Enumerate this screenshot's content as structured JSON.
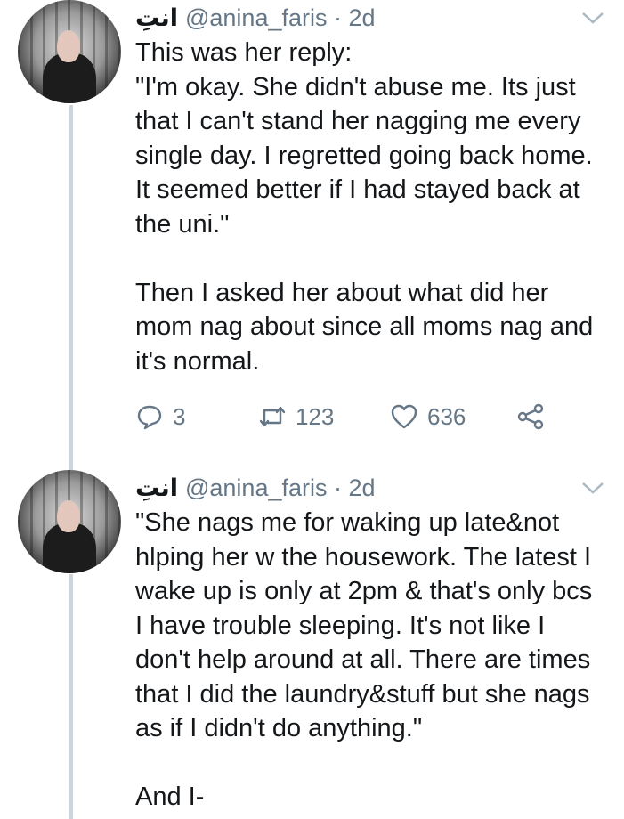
{
  "tweets": [
    {
      "display_name": "انتِ",
      "handle": "@anina_faris",
      "time": "· 2d",
      "text": "This was her reply:\n\"I'm okay. She didn't abuse me. Its just that I can't stand her nagging me every single day. I regretted going back home. It seemed better if I had stayed back at the uni.\"\n\nThen I asked her about what did her mom nag about since all moms nag and it's normal.",
      "actions": {
        "replies": "3",
        "retweets": "123",
        "likes": "636"
      }
    },
    {
      "display_name": "انتِ",
      "handle": "@anina_faris",
      "time": "· 2d",
      "text": "\"She nags me for waking up late&not hlping her w the housework. The latest I wake up is only at 2pm & that's only bcs I have trouble sleeping. It's not like I don't help around at all. There are times that I did the laundry&stuff but she nags as if I didn't do anything.\"\n\nAnd I-"
    }
  ],
  "icons": {
    "reply": "reply-icon",
    "retweet": "retweet-icon",
    "like": "heart-icon",
    "share": "share-icon",
    "menu": "chevron-down-icon"
  },
  "colors": {
    "text": "#14171a",
    "secondary": "#657786",
    "thread_line": "#ccd6dd"
  }
}
